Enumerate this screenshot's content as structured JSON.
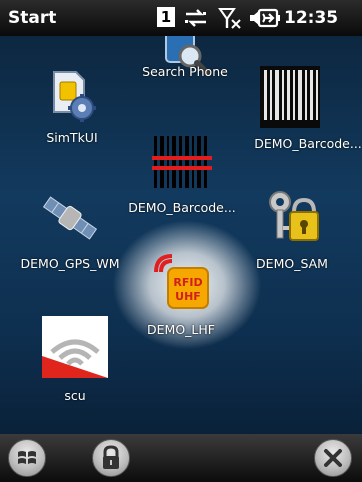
{
  "status_bar": {
    "title": "Start",
    "sim_indicator": "1",
    "time": "12:35",
    "icons": [
      "sim-slot-icon",
      "data-connection-icon",
      "no-signal-icon",
      "speaker-icon",
      "battery-charging-icon"
    ]
  },
  "desktop": {
    "tiles": [
      {
        "id": "search_phone",
        "label": "Search Phone",
        "icon": "search-phone-icon"
      },
      {
        "id": "simtkui",
        "label": "SimTkUI",
        "icon": "sim-gear-icon"
      },
      {
        "id": "demo_barcode_1",
        "label": "DEMO_Barcode...",
        "icon": "barcode-laser-icon"
      },
      {
        "id": "demo_barcode_2",
        "label": "DEMO_Barcode...",
        "icon": "barcode-icon"
      },
      {
        "id": "demo_gps_wm",
        "label": "DEMO_GPS_WM",
        "icon": "satellite-icon"
      },
      {
        "id": "demo_sam",
        "label": "DEMO_SAM",
        "icon": "keys-lock-icon"
      },
      {
        "id": "demo_lhf",
        "label": "DEMO_LHF",
        "icon": "rfid-uhf-icon",
        "selected": true,
        "icon_text": [
          "RFID",
          "UHF"
        ]
      },
      {
        "id": "scu",
        "label": "scu",
        "icon": "scu-signal-icon"
      }
    ]
  },
  "taskbar": {
    "buttons": [
      "windows-start-icon",
      "lock-icon",
      "close-icon"
    ]
  },
  "colors": {
    "background_top": "#0d2740",
    "background_mid": "#123a5e",
    "rfid_orange": "#f7a800",
    "scu_red": "#e0261c"
  }
}
